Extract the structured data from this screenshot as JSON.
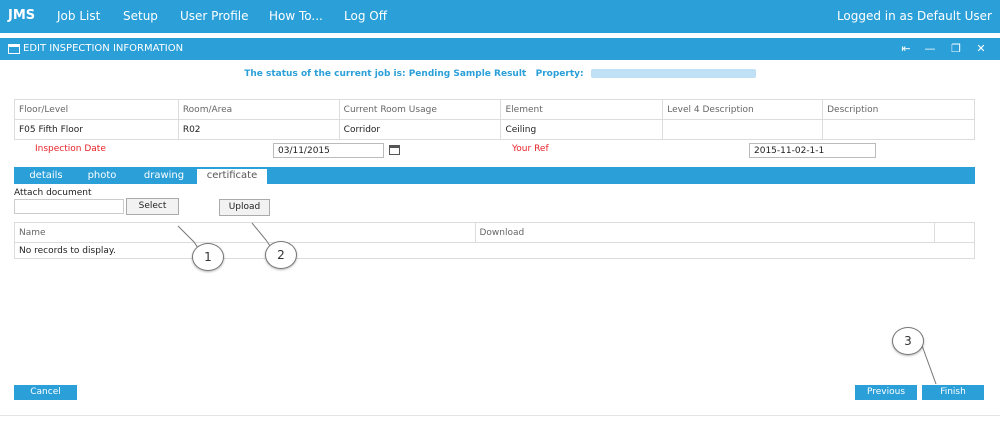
{
  "nav": {
    "brand": "JMS",
    "items": [
      "Job List",
      "Setup",
      "User Profile",
      "How To...",
      "Log Off"
    ],
    "login": "Logged in as Default User"
  },
  "window": {
    "title": "EDIT INSPECTION INFORMATION",
    "controls": [
      "⇤",
      "—",
      "❐",
      "✕"
    ]
  },
  "status": {
    "text": "The status of the current job is: Pending Sample Result",
    "property_label": "Property:"
  },
  "info_table": {
    "headers": [
      "Floor/Level",
      "Room/Area",
      "Current Room Usage",
      "Element",
      "Level 4 Description",
      "Description"
    ],
    "row": [
      "F05 Fifth Floor",
      "R02",
      "Corridor",
      "Ceiling",
      "",
      ""
    ]
  },
  "inspection": {
    "date_label": "Inspection Date",
    "date_value": "03/11/2015",
    "ref_label": "Your Ref",
    "ref_value": "2015-11-02-1-1"
  },
  "tabs": [
    {
      "label": "details",
      "active": false
    },
    {
      "label": "photo",
      "active": false
    },
    {
      "label": "drawing",
      "active": false
    },
    {
      "label": "certificate",
      "active": true
    }
  ],
  "attach": {
    "label": "Attach document",
    "select_label": "Select",
    "upload_label": "Upload"
  },
  "docs_table": {
    "headers": [
      "Name",
      "Download",
      ""
    ],
    "empty_text": "No records to display."
  },
  "callouts": [
    "1",
    "2",
    "3"
  ],
  "footer": {
    "cancel": "Cancel",
    "previous": "Previous",
    "finish": "Finish"
  },
  "colors": {
    "accent": "#2a9fd8",
    "label_red": "#e8232a"
  }
}
